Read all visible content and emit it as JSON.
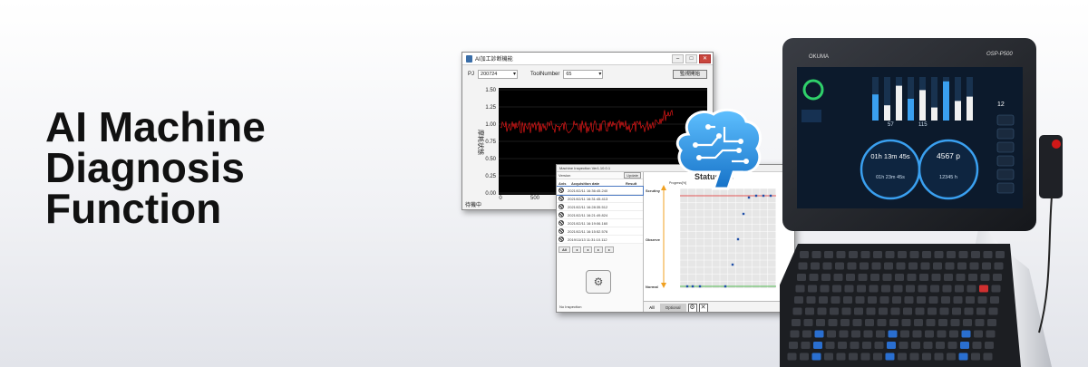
{
  "headline": {
    "line1": "AI Machine",
    "line2": "Diagnosis",
    "line3": "Function"
  },
  "window1": {
    "title": "AI加工診断機能",
    "pj_label": "PJ",
    "pj_value": "200724",
    "tool_label": "ToolNumber",
    "tool_value": "65",
    "button_label": "監視開始",
    "ylabel": "摩耗状態",
    "yticks": [
      "1.50",
      "1.25",
      "1.00",
      "0.75",
      "0.50",
      "0.25",
      "0.00"
    ],
    "xticks": [
      "0",
      "500"
    ],
    "status": "待機中"
  },
  "window2": {
    "title": "Machine Inspection Ver1.10.0.1",
    "version_label": "Version",
    "update_label": "Update",
    "col_axis": "Axis",
    "col_date": "Acquisition date",
    "col_result": "Result",
    "rows": [
      "2021/02/11  16:36:45.240",
      "2021/02/11  16:31:45.413",
      "2021/02/11  16:28:35.512",
      "2021/02/11  16:21:49.824",
      "2021/02/11  16:19:06.160",
      "2021/02/11  16:15:52.576",
      "2019/11/13  11:31:10.112"
    ],
    "filter_all": "All",
    "no_inspection": "No Inspection",
    "panel_title": "Status his",
    "progress_label": "Progress[%]",
    "lvl_scrutiny": "Scrutiny",
    "lvl_observe": "Observe",
    "lvl_normal": "Normal",
    "tab_all": "All",
    "tab_optional": "Optional",
    "accent": "#1f4fa8"
  },
  "controller": {
    "brand": "OKUMA",
    "model": "OSP-P500",
    "timer1": "01h 13m 45s",
    "count1": "4567 p",
    "timer2": "01h 23m 45s",
    "count2": "12345 h",
    "small_value": "12",
    "readout_a": "57",
    "readout_b": "115"
  },
  "colors": {
    "brain_blue": "#2a8ee0",
    "red_signal": "#e01010"
  }
}
